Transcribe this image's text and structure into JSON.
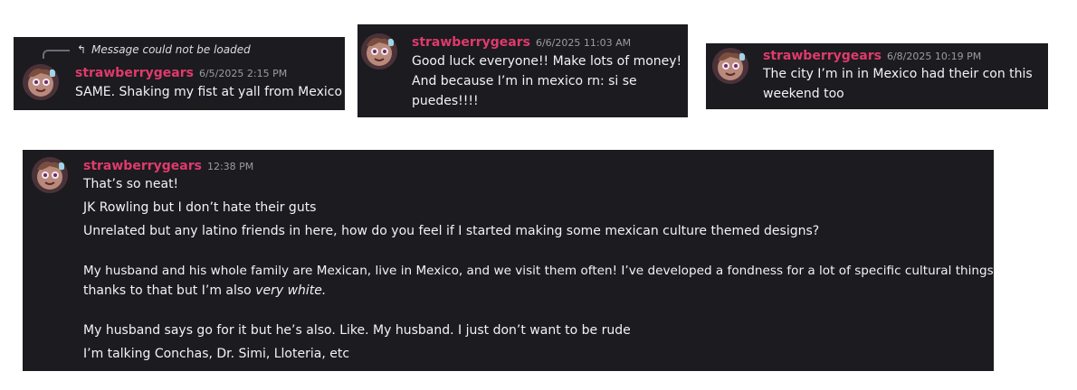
{
  "messages": [
    {
      "username": "strawberrygears",
      "timestamp": "6/5/2025 2:15 PM",
      "reply_text": "Message could not be loaded",
      "reply_icon": "reply-arrow-icon",
      "lines": [
        "SAME. Shaking my fist at yall from Mexico"
      ]
    },
    {
      "username": "strawberrygears",
      "timestamp": "6/6/2025 11:03 AM",
      "lines": [
        "Good luck everyone!! Make lots of money!",
        "And because I’m in mexico rn: si se",
        "puedes!!!!"
      ]
    },
    {
      "username": "strawberrygears",
      "timestamp": "6/8/2025 10:19 PM",
      "lines": [
        "The city I’m in in Mexico had their con this",
        "weekend too"
      ]
    },
    {
      "username": "strawberrygears",
      "timestamp": "12:38 PM",
      "lines": [
        "That’s so neat!",
        "JK Rowling but I don’t hate their guts",
        "Unrelated but any latino friends in here, how do you feel if I started making some mexican culture themed designs?",
        "My husband and his whole family are Mexican, live in Mexico, and we visit them often! I’ve developed a fondness for a lot of specific cultural things",
        "thanks to that but I’m also ",
        "very white.",
        "My husband says go for it but he’s also. Like. My husband. I just don’t want to be rude",
        "I’m talking Conchas, Dr. Simi, Lloteria, etc"
      ]
    }
  ],
  "colors": {
    "card_bg": "#1b1b20",
    "username": "#e03a6c",
    "timestamp": "#9b9ca3",
    "text": "#f2f3f5"
  }
}
